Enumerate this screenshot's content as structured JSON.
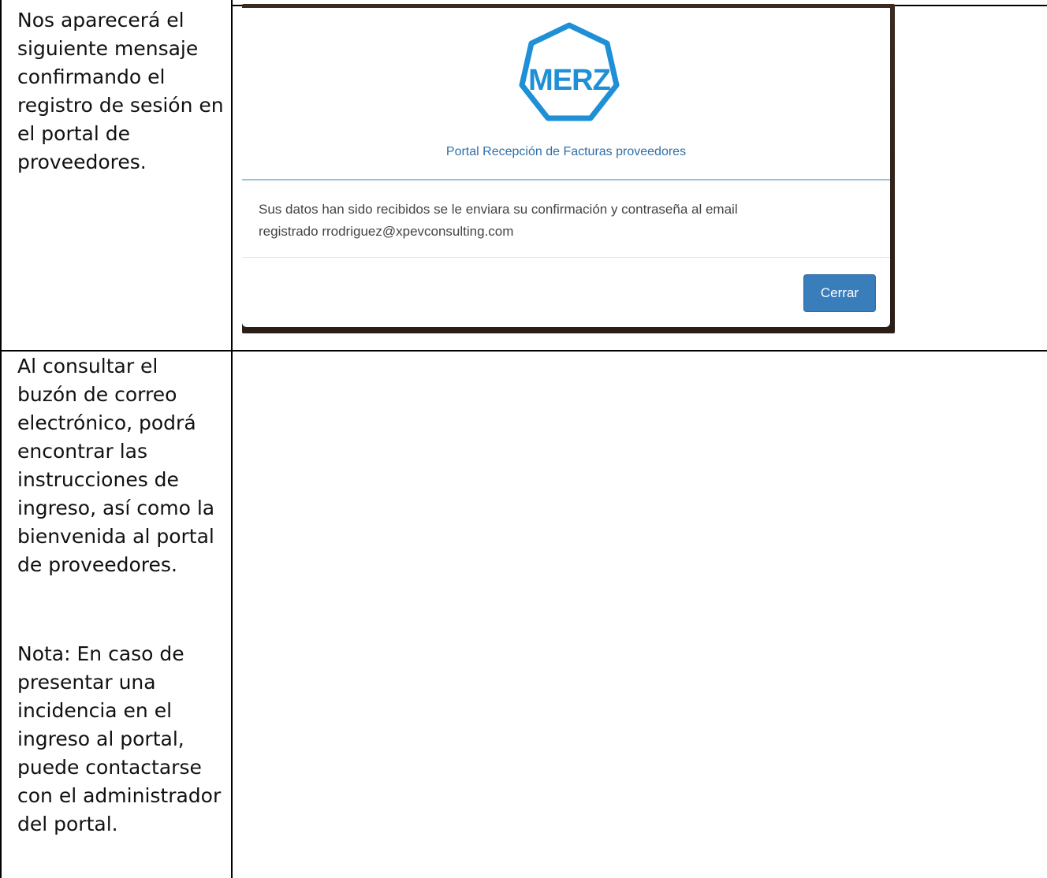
{
  "rows": [
    {
      "text": "Nos aparecerá el siguiente mensaje confirmando el registro de sesión en el portal de proveedores."
    },
    {
      "text": "Al consultar el buzón de correo electrónico, podrá encontrar las instrucciones de ingreso, así como la bienvenida al portal de proveedores.",
      "note": "Nota: En caso de presentar una incidencia en el ingreso al portal, puede contactarse con el administrador del portal."
    }
  ],
  "dialog": {
    "logo_text": "MERZ",
    "portal_title": "Portal Recepción de Facturas proveedores",
    "message_line1": "Sus datos han sido recibidos se le enviara su confirmación y contraseña al email",
    "message_line2": "registrado rrodriguez@xpevconsulting.com",
    "close_label": "Cerrar",
    "logo_color": "#1f8fd6",
    "accent_color": "#3a7dbb"
  }
}
